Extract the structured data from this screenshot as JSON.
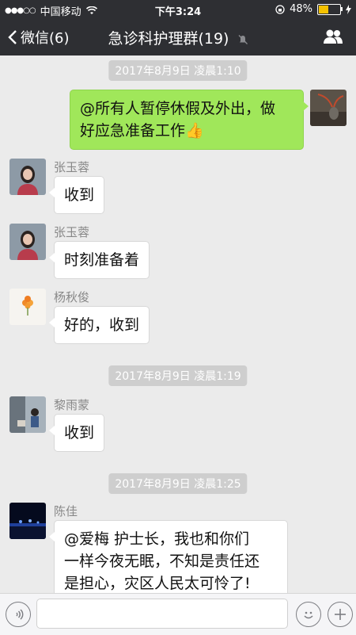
{
  "status_bar": {
    "carrier": "中国移动",
    "time": "下午3:24",
    "battery_percent": "48%",
    "battery_level": 0.48,
    "signal_icon": "signal-dots-icon",
    "wifi_icon": "wifi-icon"
  },
  "nav": {
    "back_label": "微信(6)",
    "title": "急诊科护理群(19)",
    "mute_icon": "mute-icon",
    "members_icon": "group-members-icon"
  },
  "timestamps": [
    "2017年8月9日 凌晨1:10",
    "2017年8月9日 凌晨1:19",
    "2017年8月9日 凌晨1:25"
  ],
  "messages": [
    {
      "sender": "",
      "text": "@所有人暂停休假及外出，做好应急准备工作",
      "line1": "@所有人暂停休假及外出，做",
      "line2": "好应急准备工作",
      "emoji": "👍"
    },
    {
      "sender": "张玉蓉",
      "text": "收到"
    },
    {
      "sender": "张玉蓉",
      "text": "时刻准备着"
    },
    {
      "sender": "杨秋俊",
      "text": "好的，收到"
    },
    {
      "sender": "黎雨蒙",
      "text": "收到"
    },
    {
      "sender": "陈佳",
      "lines": [
        "@爱梅  护士长，我也和你们",
        "一样今夜无眠，不知是责任还",
        "是担心，灾区人民太可怜了!"
      ]
    }
  ],
  "colors": {
    "nav_bg": "#2e2f33",
    "chat_bg": "#ebebeb",
    "own_bubble": "#a0e75a",
    "other_bubble": "#ffffff"
  },
  "input_bar": {
    "voice_icon": "voice-icon",
    "emoji_icon": "emoji-icon",
    "plus_icon": "plus-icon"
  }
}
